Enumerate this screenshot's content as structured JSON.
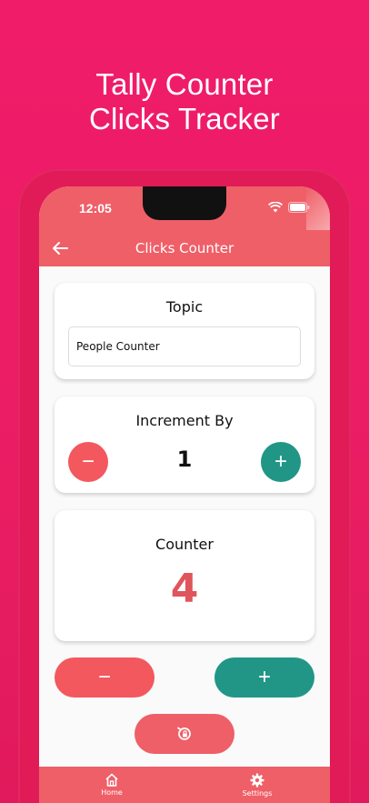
{
  "promo": {
    "headline_line1": "Tally Counter",
    "headline_line2": "Clicks Tracker"
  },
  "status_bar": {
    "time": "12:05"
  },
  "app_bar": {
    "title": "Clicks Counter"
  },
  "topic": {
    "label": "Topic",
    "value": "People Counter"
  },
  "increment": {
    "label": "Increment By",
    "value": "1",
    "minus_symbol": "−",
    "plus_symbol": "+"
  },
  "counter": {
    "label": "Counter",
    "value": "4"
  },
  "actions": {
    "decrement_symbol": "−",
    "increment_symbol": "+",
    "reset_icon": "reset-lock-icon"
  },
  "bottom_nav": {
    "items": [
      {
        "label": "Home",
        "icon": "home-icon"
      },
      {
        "label": "Settings",
        "icon": "gear-icon"
      }
    ]
  },
  "colors": {
    "background": "#ea1d63",
    "app_bar": "#ef5f67",
    "minus": "#f2585e",
    "plus": "#219686",
    "counter_value": "#e0545c"
  }
}
